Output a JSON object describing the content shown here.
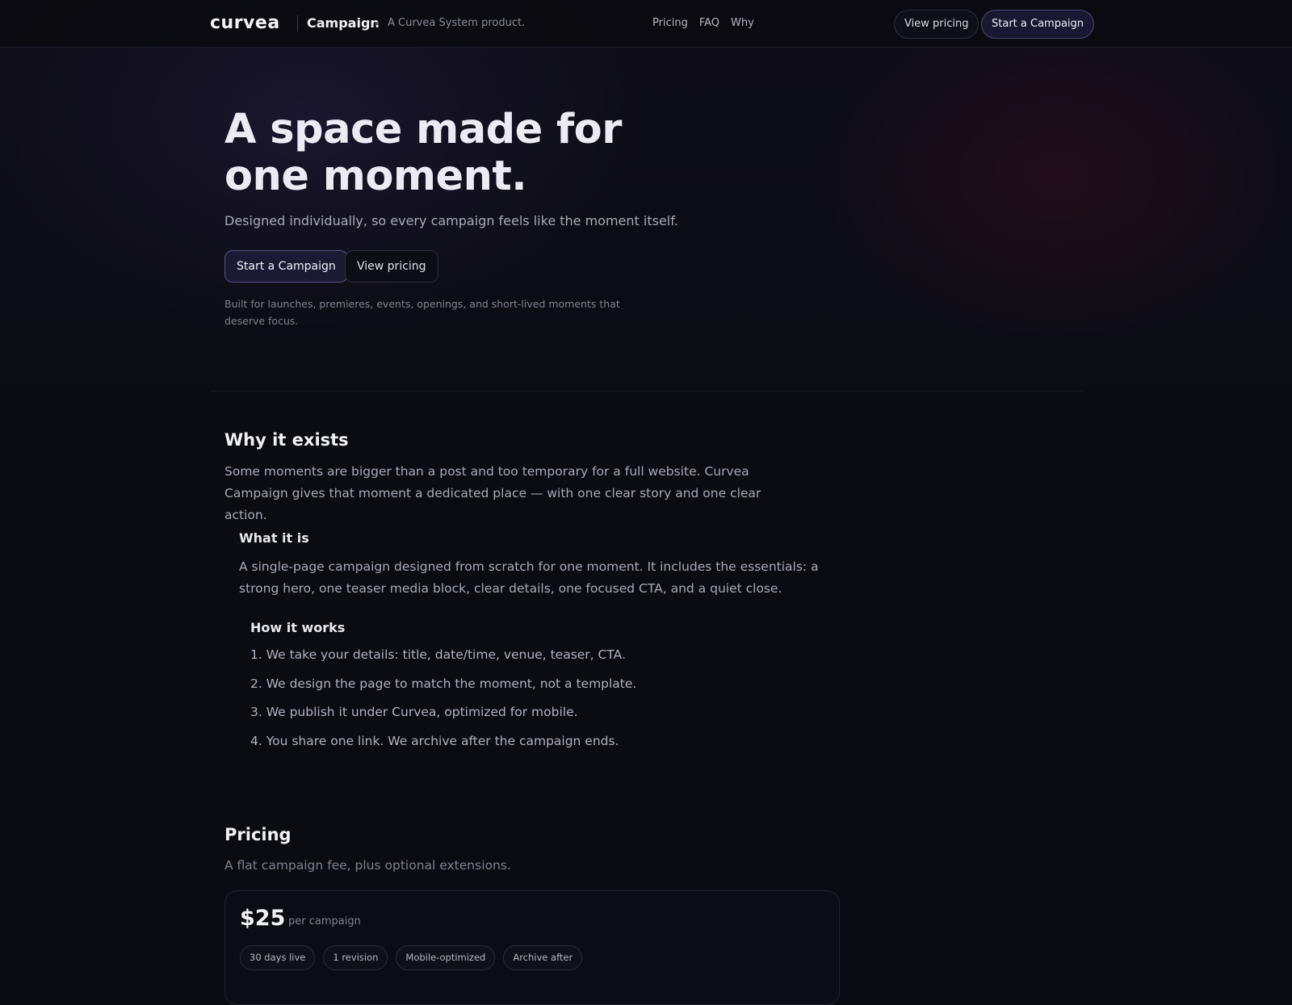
{
  "header": {
    "logo_text": "curvea",
    "product_name": "Campaign",
    "tagline": "A Curvea System product.",
    "nav": [
      "Pricing",
      "FAQ",
      "Why"
    ],
    "view_pricing_label": "View pricing",
    "start_campaign_label": "Start a Campaign"
  },
  "hero": {
    "title": "A space made for one moment.",
    "subtitle": "Designed individually, so every campaign feels like the moment itself.",
    "primary_cta": "Start a Campaign",
    "secondary_cta": "View pricing",
    "note": "Built for launches, premieres, events, openings, and short-lived moments that deserve focus."
  },
  "why": {
    "title": "Why it exists",
    "body": "Some moments are bigger than a post and too temporary for a full website. Curvea Campaign gives that moment a dedicated place — with one clear story and one clear action."
  },
  "what": {
    "title": "What it is",
    "body": "A single-page campaign designed from scratch for one moment. It includes the essentials: a strong hero, one teaser media block, clear details, one focused CTA, and a quiet close."
  },
  "how": {
    "title": "How it works",
    "steps": [
      "1. We take your details: title, date/time, venue, teaser, CTA.",
      "2. We design the page to match the moment, not a template.",
      "3. We publish it under Curvea, optimized for mobile.",
      "4. You share one link. We archive after the campaign ends."
    ]
  },
  "pricing": {
    "title": "Pricing",
    "subtitle": "A flat campaign fee, plus optional extensions.",
    "price": "$25",
    "unit": "per campaign",
    "features": [
      "30 days live",
      "1 revision",
      "Mobile-optimized",
      "Archive after"
    ]
  },
  "colors": {
    "background": "#0b0c12",
    "accent": "#5a5089",
    "text": "#ecebf3"
  }
}
